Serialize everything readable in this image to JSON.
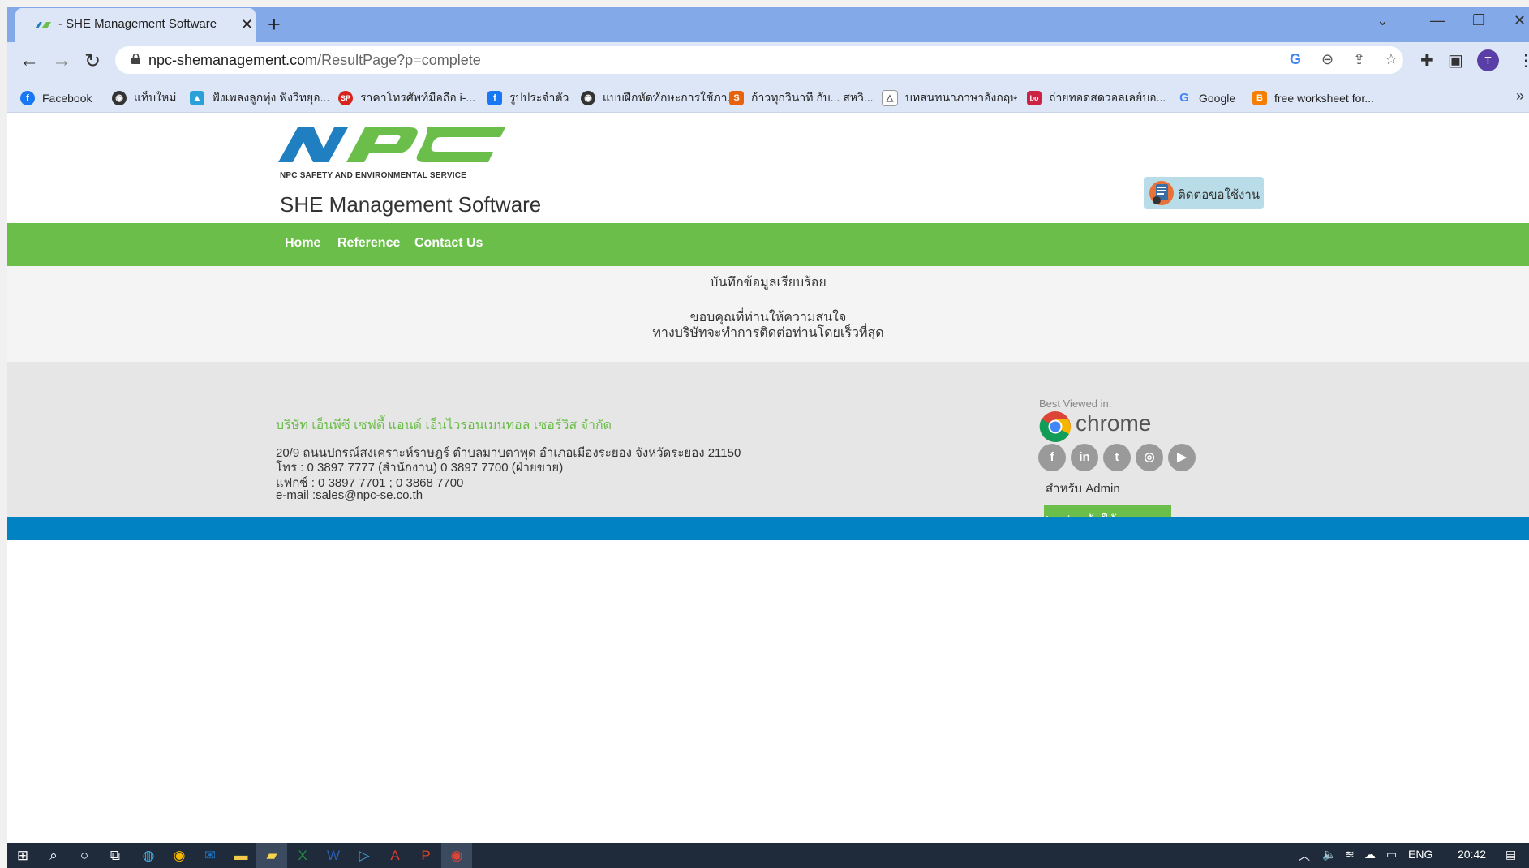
{
  "browser": {
    "tab_title": "- SHE Management Software",
    "tab_close": "✕",
    "new_tab": "+",
    "url_domain": "npc-shemanagement.com",
    "url_path": "/ResultPage?p=complete",
    "avatar_letter": "T",
    "bookmarks": [
      {
        "label": "Facebook",
        "icon": "facebook-icon",
        "color": "#1877f2",
        "glyph": "f"
      },
      {
        "label": "แท็บใหม่",
        "icon": "globe-icon",
        "color": "#333333",
        "glyph": "◉"
      },
      {
        "label": "ฟังเพลงลูกทุ่ง ฟังวิทยุอ...",
        "icon": "radio-icon",
        "color": "#2aa0d8",
        "glyph": "▲"
      },
      {
        "label": "ราคาโทรศัพท์มือถือ i-...",
        "icon": "sp-icon",
        "color": "#d6231d",
        "glyph": "SP"
      },
      {
        "label": "รูปประจำตัว",
        "icon": "facebook-icon",
        "color": "#1877f2",
        "glyph": "f"
      },
      {
        "label": "แบบฝึกหัดทักษะการใช้ภา...",
        "icon": "globe-icon",
        "color": "#333333",
        "glyph": "◉"
      },
      {
        "label": "ก้าวทุกวินาที กับ... สหวิ...",
        "icon": "s-icon",
        "color": "#e8620c",
        "glyph": "S"
      },
      {
        "label": "บทสนทนาภาษาอังกฤษ",
        "icon": "triangle-icon",
        "color": "#777777",
        "glyph": "△"
      },
      {
        "label": "ถ่ายทอดสดวอลเลย์บอ...",
        "icon": "bo-icon",
        "color": "#cc2244",
        "glyph": "bo"
      },
      {
        "label": "Google",
        "icon": "google-icon",
        "color": "#4285f4",
        "glyph": "G"
      },
      {
        "label": "free worksheet for...",
        "icon": "blogger-icon",
        "color": "#f57d00",
        "glyph": "B"
      }
    ],
    "bookmarks_more": "»"
  },
  "site": {
    "logo_sub": "NPC SAFETY AND ENVIRONMENTAL SERVICE",
    "title": "SHE Management Software",
    "contact_button": "ติดต่อขอใช้งาน",
    "nav": [
      "Home",
      "Reference",
      "Contact Us"
    ],
    "colors": {
      "green": "#6cbe4b",
      "blue": "#0182c2",
      "logo_blue": "#1f7fc1"
    }
  },
  "result": {
    "line1": "บันทึกข้อมูลเรียบร้อย",
    "line2": "ขอบคุณที่ท่านให้ความสนใจ",
    "line3": "ทางบริษัทจะทำการติดต่อท่านโดยเร็วที่สุด"
  },
  "footer": {
    "company": "บริษัท เอ็นพีซี เซฟตี้ แอนด์ เอ็นไวรอนเมนทอล เซอร์วิส จำกัด",
    "address": "20/9 ถนนปกรณ์สงเคราะห์ราษฎร์ ตำบลมาบตาพุด อำเภอเมืองระยอง จังหวัดระยอง 21150",
    "phone": "โทร : 0 3897 7777 (สำนักงาน) 0 3897 7700 (ฝ่ายขาย)",
    "fax": "แฟกซ์ : 0 3897 7701 ; 0 3868 7700",
    "email": "e-mail :sales@npc-se.co.th",
    "best_viewed": "Best Viewed in:",
    "chrome_word": "chrome",
    "social": [
      "facebook-icon",
      "linkedin-icon",
      "twitter-icon",
      "instagram-icon",
      "youtube-icon"
    ],
    "admin_label": "สำหรับ Admin",
    "login_button": "Login เข้าใช้งานระบบ"
  },
  "taskbar": {
    "lang": "ENG",
    "time": "20:42"
  }
}
